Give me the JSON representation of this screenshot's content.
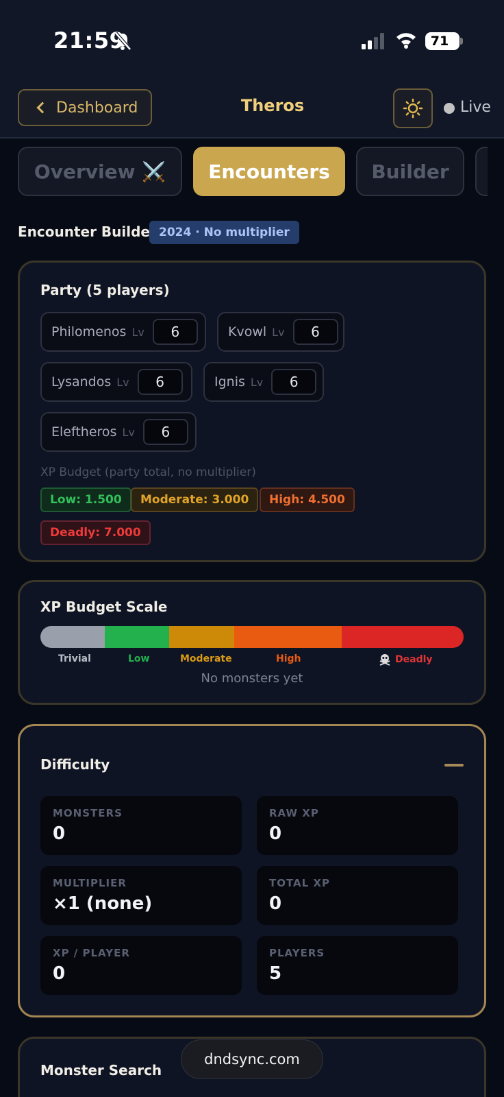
{
  "status_bar": {
    "time": "21:59",
    "battery": "71"
  },
  "header": {
    "back_label": "Dashboard",
    "title": "Theros",
    "live_label": "Live"
  },
  "tabs": [
    {
      "label": "Overview ⚔️"
    },
    {
      "label": "Encounters"
    },
    {
      "label": "Builder"
    }
  ],
  "encounter_builder": {
    "heading": "Encounter Builder",
    "rules_badge": "2024 · No multiplier"
  },
  "party": {
    "title": "Party (5 players)",
    "lv_label": "Lv",
    "players": [
      {
        "name": "Philomenos",
        "level": "6"
      },
      {
        "name": "Kvowl",
        "level": "6"
      },
      {
        "name": "Lysandos",
        "level": "6"
      },
      {
        "name": "Ignis",
        "level": "6"
      },
      {
        "name": "Eleftheros",
        "level": "6"
      }
    ],
    "budget_caption": "XP Budget (party total, no multiplier)",
    "budgets": {
      "low": "Low: 1.500",
      "moderate": "Moderate: 3.000",
      "high": "High: 4.500",
      "deadly": "Deadly: 7.000"
    }
  },
  "xp_scale": {
    "title": "XP Budget Scale",
    "labels": {
      "trivial": "Trivial",
      "low": "Low",
      "moderate": "Moderate",
      "high": "High",
      "deadly": "Deadly"
    },
    "deadly_icon": "skull-crossbones-icon",
    "empty_text": "No monsters yet",
    "colors": {
      "trivial": "#9aa0ab",
      "low": "#22b14c",
      "moderate": "#cc8a08",
      "high": "#ea5b12",
      "deadly": "#dc2626"
    }
  },
  "difficulty": {
    "title": "Difficulty",
    "stats": {
      "monsters": {
        "label": "MONSTERS",
        "value": "0"
      },
      "raw_xp": {
        "label": "RAW XP",
        "value": "0"
      },
      "multiplier": {
        "label": "MULTIPLIER",
        "value": "×1 (none)"
      },
      "total_xp": {
        "label": "TOTAL XP",
        "value": "0"
      },
      "xp_per_player": {
        "label": "XP / PLAYER",
        "value": "0"
      },
      "players": {
        "label": "PLAYERS",
        "value": "5"
      }
    }
  },
  "monster_search": {
    "title": "Monster Search"
  },
  "browser": {
    "url": "dndsync.com"
  },
  "colors": {
    "accent": "#caa64f",
    "background": "#070b16"
  }
}
